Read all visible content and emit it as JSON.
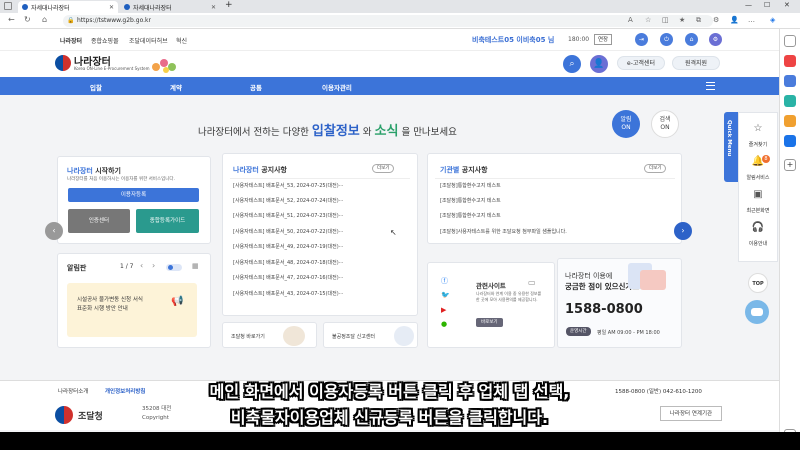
{
  "browser": {
    "tabs": [
      {
        "label": "자세대나라장터",
        "active": true
      },
      {
        "label": "자세대나라장터",
        "active": false
      }
    ],
    "new_tab": "+",
    "url": "https://tstwww.g2b.go.kr"
  },
  "util_bar": {
    "links": [
      "나라장터",
      "종합쇼핑몰",
      "조달데이터허브",
      "혁신"
    ],
    "user_text": "비축테스트05 이비축05 님",
    "timer": "180:00",
    "extend_label": "연장"
  },
  "header": {
    "logo_title": "나라장터",
    "logo_sub": "Korea ON-Line E-Procurement System",
    "customer_center": "e-고객센터",
    "remote_support": "원격지원"
  },
  "nav": {
    "items": [
      "입찰",
      "계약",
      "공통",
      "이용자관리"
    ]
  },
  "headline": {
    "prefix": "나라장터에서 전하는 다양한",
    "word1": "입찰정보",
    "and": "와",
    "word2": "소식",
    "suffix": "을 만나보세요"
  },
  "toggles": {
    "alarm_line1": "알림",
    "alarm_line2": "ON",
    "search_line1": "검색",
    "search_line2": "ON"
  },
  "start_card": {
    "title_prefix": "나라장터",
    "title_suffix": " 시작하기",
    "desc": "나라장터를 처음 이용하시는 이용자를 위한 서비스입니다.",
    "register_btn": "이용자등록",
    "cert_btn": "인증센터",
    "guide_btn": "종합등록가이드"
  },
  "alarm_card": {
    "title": "알림판",
    "pager": "1 / 7",
    "msg_line1": "시설공사 물가변동 신청 서식",
    "msg_line2": "표준화 시행 방안 안내"
  },
  "notice_card": {
    "title_prefix": "나라장터",
    "title_suffix": " 공지사항",
    "more": "더보기",
    "rows": [
      "[사용자테스트] 배포문서_53, 2024-07-25(대전)···",
      "[사용자테스트] 배포문서_52, 2024-07-24(대전)···",
      "[사용자테스트] 배포문서_51, 2024-07-23(대전)···",
      "[사용자테스트] 배포문서_50, 2024-07-22(대전)···",
      "[사용자테스트] 배포문서_49, 2024-07-19(대전)···",
      "[사용자테스트] 배포문서_48, 2024-07-18(대전)···",
      "[사용자테스트] 배포문서_47, 2024-07-16(대전)···",
      "[사용자테스트] 배포문서_43, 2024-07-15(대전)···"
    ]
  },
  "agency_card": {
    "title_prefix": "기관별",
    "title_suffix": " 공지사항",
    "more": "더보기",
    "rows": [
      "[조달청]통합환수고지 테스트",
      "[조달청]통합환수고지 테스트",
      "[조달청]통합환수고지 테스트",
      "[조달청]사용자테스트를 위한 조달요청 첨부파일 샘플입니다."
    ]
  },
  "bottom_links": {
    "guide": "조달청 바로가기",
    "report": "불공정조달 신고센터"
  },
  "related_sites": {
    "title": "관련사이트",
    "desc": "나라장터와 연계 이용 중 유용한 정보를 한 곳에 모아 사용편의를 제공합니다.",
    "more": "바로보기"
  },
  "help_card": {
    "line1": "나라장터 이용에",
    "line2": "궁금한 점이 있으신가요?",
    "phone": "1588-0800",
    "hours_label": "운영시간",
    "hours": "평일 AM 09:00 - PM 18:00"
  },
  "quick_menu": {
    "tab": "Quick Menu",
    "items": [
      "즐겨찾기",
      "알림서비스",
      "최근본화면",
      "이용안내"
    ],
    "badge": "8",
    "top": "TOP"
  },
  "footer": {
    "links": [
      "나라장터소개",
      "개인정보처리방침"
    ],
    "phone_text": "1588-0800 (일반) 042-610-1200",
    "agency": "조달청",
    "address": "35208 대전",
    "copyright": "Copyright",
    "related_btn": "나라장터 연계기관"
  },
  "subtitles": {
    "line1": "메인 화면에서 이용자등록 버튼 클릭 후 업체 탭 선택,",
    "line2": "비축물자이용업체 신규등록 버튼을 클릭합니다."
  }
}
